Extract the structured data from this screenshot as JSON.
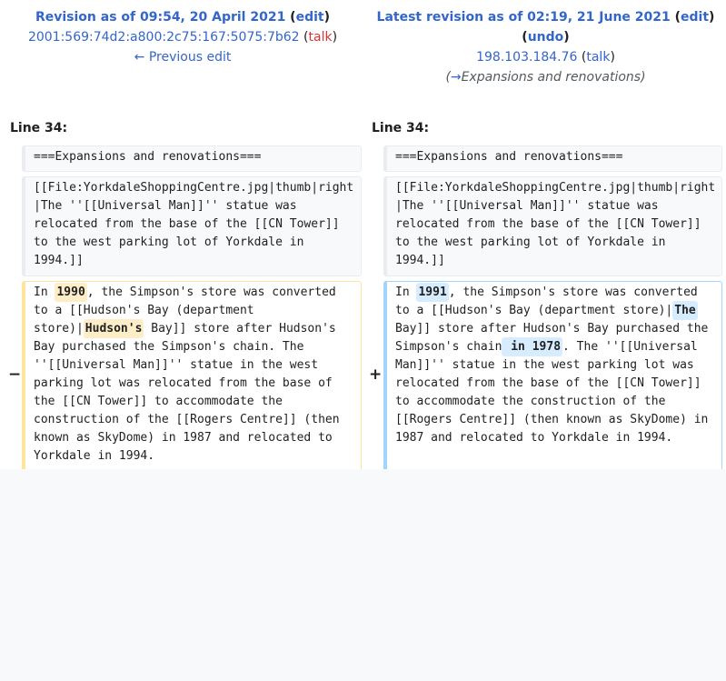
{
  "left_header": {
    "title_prefix": "Revision as of 09:54, 20 April 2021",
    "open_paren": " (",
    "edit_label": "edit",
    "close_paren": ")",
    "user": "2001:569:74d2:a800:2c75:167:5075:7b62",
    "talk_open": " (",
    "talk_label": "talk",
    "talk_close": ")",
    "prev_edit_label": "← Previous edit"
  },
  "right_header": {
    "title_prefix": "Latest revision as of 02:19, 21 June 2021",
    "open_paren": " (",
    "edit_label": "edit",
    "close_paren": ")",
    "undo_open": "(",
    "undo_label": "undo",
    "undo_close": ")",
    "user": "198.103.184.76",
    "talk_open": " (",
    "talk_label": "talk",
    "talk_close": ")",
    "summary_open": "(",
    "summary_arrow": "→",
    "summary_text": "Expansions and renovations",
    "summary_close": ")"
  },
  "line_label_left": "Line 34:",
  "line_label_right": "Line 34:",
  "minus_marker": "−",
  "plus_marker": "+",
  "context_heading": "===Expansions and renovations===",
  "context_file": "[[File:YorkdaleShoppingCentre.jpg|thumb|right\n|The ''[[Universal Man]]'' statue was\nrelocated from the base of the [[CN Tower]]\nto the west parking lot of Yorkdale in\n1994.]]",
  "del": {
    "p1": "In ",
    "h1": "1990",
    "p2": ", the Simpson's store was converted\nto a [[Hudson's Bay (department\nstore)|",
    "h2": "Hudson's",
    "p3": " Bay]] store after Hudson's\nBay purchased the Simpson's chain. The\n''[[Universal Man]]'' statue in the west\nparking lot was relocated from the base of\nthe [[CN Tower]] to accommodate the\nconstruction of the [[Rogers Centre]] (then\nknown as SkyDome) in 1987 and relocated to\nYorkdale in 1994."
  },
  "ins": {
    "p1": "In ",
    "h1": "1991",
    "p2": ", the Simpson's store was converted\nto a [[Hudson's Bay (department store)|",
    "h2": "The",
    "p3": "\nBay]] store after Hudson's Bay purchased the\nSimpson's chain",
    "h3": " in 1978",
    "p4": ". The ''[[Universal\nMan]]'' statue in the west parking lot was\nrelocated from the base of the [[CN Tower]]\nto accommodate the construction of the\n[[Rogers Centre]] (then known as SkyDome) in\n1987 and relocated to Yorkdale in 1994."
  }
}
